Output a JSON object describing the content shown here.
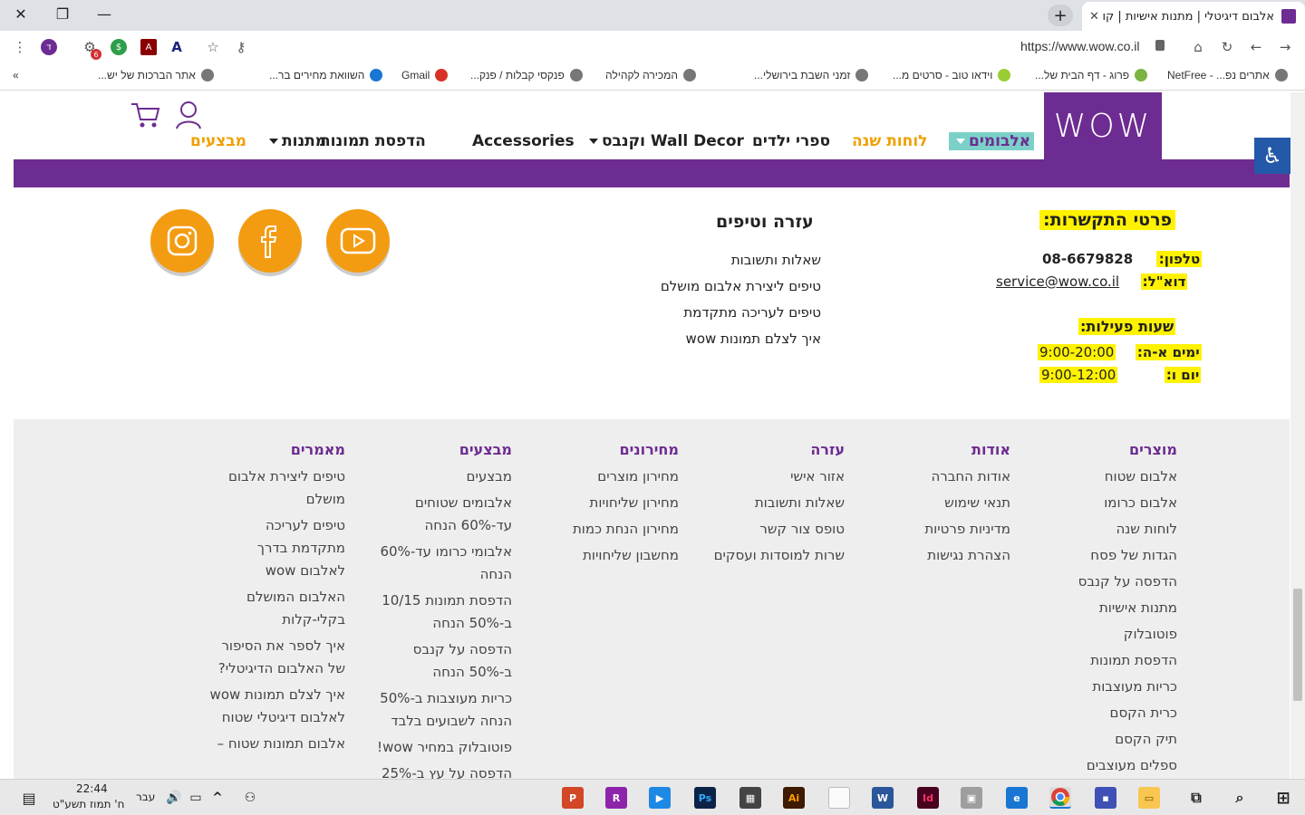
{
  "browser": {
    "tab_title": "אלבום דיגיטלי | מתנות אישיות | קו",
    "url": "https://www.wow.co.il",
    "ext_badge": "6",
    "profile_initial": "ד"
  },
  "bookmarks": [
    "אתרים נפ... - NetFree",
    "פרוג - דף הבית של...",
    "וידאו טוב - סרטים מ...",
    "זמני השבת בירושלי...",
    "המכירה לקהילה",
    "פנקסי קבלות / פנק...",
    "Gmail",
    "השוואת מחירים בר...",
    "אתר הברכות של יש..."
  ],
  "site": {
    "logo": "WOW",
    "nav": {
      "albums": "אלבומים",
      "calendars": "לוחות שנה",
      "kids_books": "ספרי ילדים",
      "wall_decor": "Wall Decor וקנבס",
      "accessories": "Accessories",
      "photo_print": "הדפסת תמונות",
      "gifts": "מתנות",
      "deals": "מבצעים"
    },
    "contact": {
      "title": "פרטי התקשרות:",
      "phone_label": "טלפון:",
      "phone": "08-6679828",
      "email_label": "דוא\"ל:",
      "email": "service@wow.co.il",
      "hours_title": "שעות פעילות:",
      "days1_label": "ימים א-ה:",
      "days1_hours": "9:00-20:00",
      "days2_label": "יום ו:",
      "days2_hours": "9:00-12:00"
    },
    "help": {
      "title": "עזרה וטיפים",
      "items": [
        "שאלות ותשובות",
        "טיפים ליצירת אלבום מושלם",
        "טיפים לעריכה מתקדמת",
        "איך לצלם תמונות wow"
      ]
    },
    "footer": {
      "products": {
        "title": "מוצרים",
        "items": [
          "אלבום שטוח",
          "אלבום כרומו",
          "לוחות שנה",
          "הגדות של פסח",
          "הדפסה על קנבס",
          "מתנות אישיות",
          "פוטובלוק",
          "הדפסת תמונות",
          "כריות מעוצבות",
          "כרית הקסם",
          "תיק הקסם",
          "ספלים מעוצבים"
        ]
      },
      "about": {
        "title": "אודות",
        "items": [
          "אודות החברה",
          "תנאי שימוש",
          "מדיניות פרטיות",
          "הצהרת נגישות"
        ]
      },
      "help": {
        "title": "עזרה",
        "items": [
          "אזור אישי",
          "שאלות ותשובות",
          "טופס צור קשר",
          "שרות למוסדות ועסקים"
        ]
      },
      "pricing": {
        "title": "מחירונים",
        "items": [
          "מחירון מוצרים",
          "מחירון שליחויות",
          "מחירון הנחת כמות",
          "מחשבון שליחויות"
        ]
      },
      "deals": {
        "title": "מבצעים",
        "items": [
          "מבצעים",
          "אלבומים שטוחים עד-60% הנחה",
          "אלבומי כרומו עד-60% הנחה",
          "הדפסת תמונות 10/15 ב-50% הנחה",
          "הדפסה על קנבס ב-50% הנחה",
          "כריות מעוצבות ב-50% הנחה לשבועים בלבד",
          "פוטובלוק במחיר wow!",
          "הדפסה על עץ ב-25%"
        ]
      },
      "articles": {
        "title": "מאמרים",
        "items": [
          "טיפים ליצירת אלבום מושלם",
          "טיפים לעריכה מתקדמת בדרך לאלבום wow",
          "האלבום המושלם בקלי-קלות",
          "איך לספר את הסיפור של האלבום הדיגיטלי?",
          "איך לצלם תמונות wow לאלבום דיגיטלי שטוח",
          "אלבום תמונות שטוח –"
        ]
      }
    }
  },
  "taskbar": {
    "time": "22:44",
    "date": "ח' תמוז תשע\"ט",
    "lang": "עבר"
  },
  "colors": {
    "brand_purple": "#6d2c91",
    "accent_orange": "#f39c12",
    "highlight_yellow": "#fff200",
    "albums_teal": "#7bd1c8"
  }
}
